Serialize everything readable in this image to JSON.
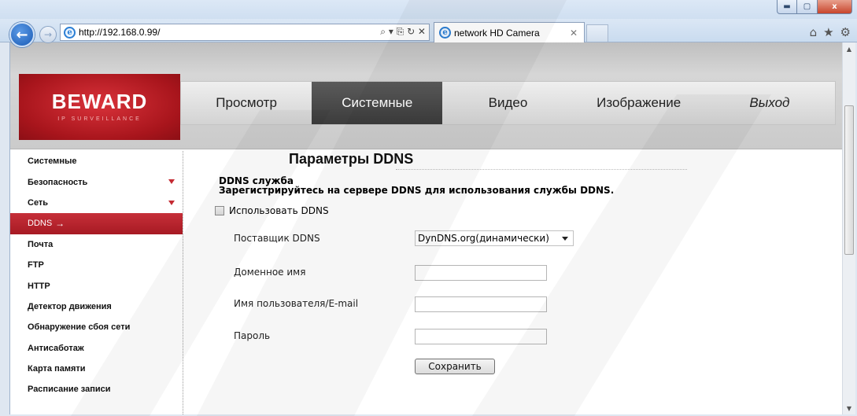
{
  "browser": {
    "url": "http://192.168.0.99/",
    "tab_title": "network HD Camera",
    "address_tools": "⌕ ▾ ⎘ ↻ ✕",
    "tab_close": "✕",
    "window_controls": {
      "minimize": "▬",
      "maximize": "▢",
      "close": "x"
    },
    "icons": {
      "back": "←",
      "forward": "→",
      "ie": "e",
      "home": "⌂",
      "favorites": "★",
      "settings": "⚙"
    }
  },
  "brand": {
    "logo_text": "BEWARD",
    "logo_sub": "IP SURVEILLANCE",
    "logo_colors": {
      "primary": "#c62f39",
      "dark": "#8c0f15"
    }
  },
  "menu": {
    "items": [
      "Просмотр",
      "Системные",
      "Видео",
      "Изображение",
      "Выход"
    ],
    "active_index": 1,
    "active_color": "#4a4a4a"
  },
  "sidebar": {
    "items": [
      {
        "label": "Системные"
      },
      {
        "label": "Безопасность",
        "expandable": true
      },
      {
        "label": "Сеть",
        "expandable": true
      },
      {
        "label": "DDNS",
        "active": true
      },
      {
        "label": "Почта"
      },
      {
        "label": "FTP"
      },
      {
        "label": "HTTP"
      },
      {
        "label": "Детектор движения"
      },
      {
        "label": "Обнаружение сбоя сети"
      },
      {
        "label": "Антисаботаж"
      },
      {
        "label": "Карта памяти"
      },
      {
        "label": "Расписание записи"
      }
    ],
    "active_arrow": "→",
    "active_color": "#b8222b"
  },
  "content": {
    "title": "Параметры DDNS",
    "service_title": "DDNS служба",
    "service_desc": "Зарегистрируйтесь на сервере DDNS для использования службы DDNS.",
    "use_ddns_label": "Использовать DDNS",
    "use_ddns_checked": false,
    "fields": {
      "provider_label": "Поставщик DDNS",
      "provider_value": "DynDNS.org(динамически)",
      "domain_label": "Доменное имя",
      "domain_value": "",
      "user_label": "Имя пользователя/E-mail",
      "user_value": "",
      "password_label": "Пароль",
      "password_value": ""
    },
    "save_label": "Сохранить"
  }
}
